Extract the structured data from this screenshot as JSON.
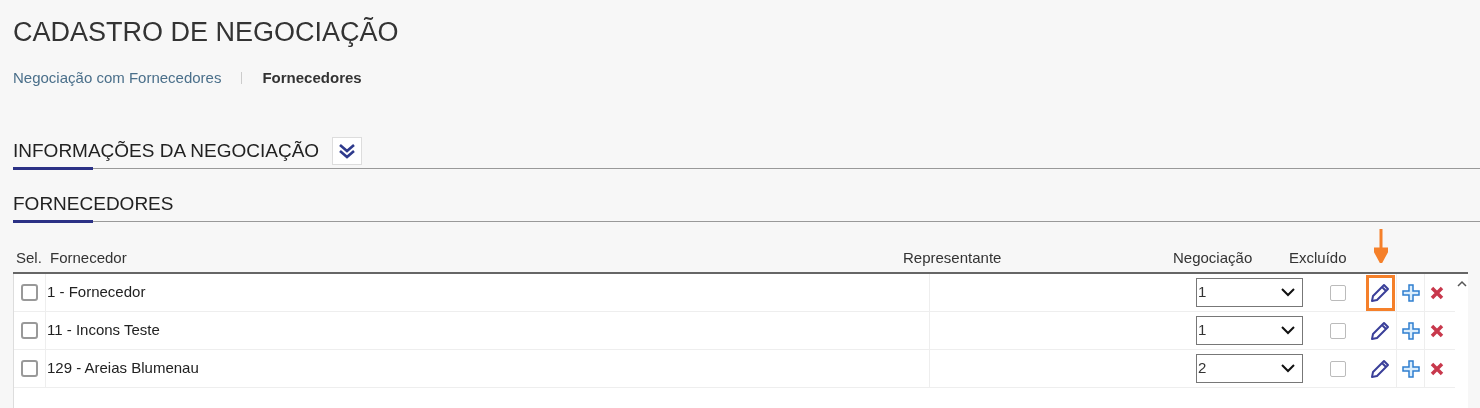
{
  "title": "CADASTRO DE NEGOCIAÇÃO",
  "breadcrumb": [
    {
      "label": "Negociação com Fornecedores",
      "current": false
    },
    {
      "label": "Fornecedores",
      "current": true
    }
  ],
  "sections": [
    {
      "title": "INFORMAÇÕES DA NEGOCIAÇÃO",
      "collapsible": true
    },
    {
      "title": "FORNECEDORES",
      "collapsible": false
    }
  ],
  "table": {
    "columns": [
      "Sel.",
      "Fornecedor",
      "Representante",
      "Negociação",
      "Excluído"
    ],
    "rows": [
      {
        "selected": false,
        "fornecedor": "1 - Fornecedor",
        "negociacao": "1",
        "excluido": false,
        "edit_highlighted": true
      },
      {
        "selected": false,
        "fornecedor": "11 - Incons Teste",
        "negociacao": "1",
        "excluido": false,
        "edit_highlighted": false
      },
      {
        "selected": false,
        "fornecedor": "129 - Areias Blumenau",
        "negociacao": "2",
        "excluido": false,
        "edit_highlighted": false
      }
    ]
  }
}
